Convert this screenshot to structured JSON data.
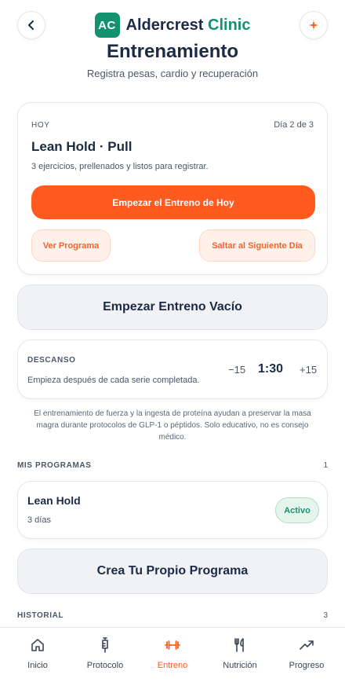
{
  "header": {
    "brand_initials": "AC",
    "brand_name_main": "Aldercrest",
    "brand_name_accent": "Clinic",
    "title": "Entrenamiento",
    "subtitle": "Registra pesas, cardio y recuperación",
    "back_icon": "chevron-left-icon",
    "spark_icon": "sparkle-icon"
  },
  "today": {
    "label": "HOY",
    "day": "Día 2 de 3",
    "title": "Lean Hold · Pull",
    "description": "3 ejercicios, prellenados y listos para registrar.",
    "start_label": "Empezar el Entreno de Hoy",
    "view_program_label": "Ver Programa",
    "skip_label": "Saltar al Siguiente Día"
  },
  "empty_workout_label": "Empezar Entreno Vacío",
  "rest": {
    "label": "DESCANSO",
    "description": "Empieza después de cada serie completada.",
    "minus_label": "−15",
    "time": "1:30",
    "plus_label": "+15"
  },
  "disclaimer": "El entrenamiento de fuerza y la ingesta de proteína ayudan a preservar la masa magra durante protocolos de GLP-1 o péptidos. Solo educativo, no es consejo médico.",
  "programs": {
    "label": "MIS PROGRAMAS",
    "count": "1",
    "items": [
      {
        "name": "Lean Hold",
        "days": "3 días",
        "badge": "Activo"
      }
    ],
    "create_label": "Crea Tu Propio Programa"
  },
  "history": {
    "label": "HISTORIAL",
    "count": "3"
  },
  "nav": [
    {
      "label": "Inicio",
      "icon": "home-icon",
      "active": false
    },
    {
      "label": "Protocolo",
      "icon": "syringe-icon",
      "active": false
    },
    {
      "label": "Entreno",
      "icon": "dumbbell-icon",
      "active": true
    },
    {
      "label": "Nutrición",
      "icon": "fork-knife-icon",
      "active": false
    },
    {
      "label": "Progreso",
      "icon": "trending-up-icon",
      "active": false
    }
  ],
  "colors": {
    "accent_orange": "#ff5a1f",
    "brand_green": "#13926f",
    "navy": "#1c2b45"
  }
}
